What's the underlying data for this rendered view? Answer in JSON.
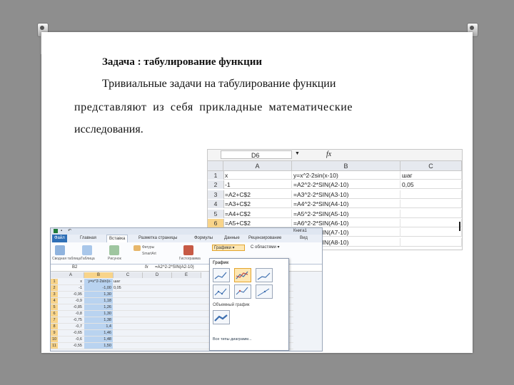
{
  "slide": {
    "title": "Задача : табулирование функции",
    "line1": "Тривиальные задачи на табулирование функции",
    "line2": "представляют из себя прикладные математические",
    "line3": "исследования."
  },
  "sheet_top": {
    "name_box": "D6",
    "fx": "fx",
    "columns": [
      "A",
      "B",
      "C"
    ],
    "rows": [
      {
        "n": "1",
        "a": "x",
        "b": "y=x^2-2sin(x-10)",
        "c": "шаг"
      },
      {
        "n": "2",
        "a": "-1",
        "b": "=A2^2-2*SIN(A2-10)",
        "c": "0,05"
      },
      {
        "n": "3",
        "a": "=A2+C$2",
        "b": "=A3^2-2*SIN(A3-10)",
        "c": ""
      },
      {
        "n": "4",
        "a": "=A3+C$2",
        "b": "=A4^2-2*SIN(A4-10)",
        "c": ""
      },
      {
        "n": "5",
        "a": "=A4+C$2",
        "b": "=A5^2-2*SIN(A5-10)",
        "c": ""
      },
      {
        "n": "6",
        "a": "=A5+C$2",
        "b": "=A6^2-2*SIN(A6-10)",
        "c": ""
      },
      {
        "n": "7",
        "a": "=A6+C$2",
        "b": "=A7^2-2*SIN(A7-10)",
        "c": ""
      },
      {
        "n": "8",
        "a": "=A7+C$2",
        "b": "=A8^2-2*SIN(A8-10)",
        "c": ""
      }
    ]
  },
  "excel_bottom": {
    "window_title": "Книга1",
    "tabs": [
      "Файл",
      "Главная",
      "Вставка",
      "Разметка страницы",
      "Формулы",
      "Данные",
      "Рецензирование",
      "Вид"
    ],
    "active_tab_index": 2,
    "ribbon_labels": [
      "Сводная таблица",
      "Таблица",
      "Рисунок",
      "Фигуры",
      "SmartArt",
      "Гистограмма",
      "Графики",
      "С областями"
    ],
    "name_box": "B2",
    "formula": "=A2^2-2*SIN(A2-10)",
    "columns": [
      "A",
      "B",
      "C",
      "D",
      "E"
    ],
    "rows": [
      {
        "n": "1",
        "a": "x",
        "b": "y=x^2-2sin(x-10)",
        "c": "шаг"
      },
      {
        "n": "2",
        "a": "-1",
        "b": "-1,00",
        "c": "0,05"
      },
      {
        "n": "3",
        "a": "-0,95",
        "b": "1,30",
        "c": ""
      },
      {
        "n": "4",
        "a": "-0,9",
        "b": "1,18",
        "c": ""
      },
      {
        "n": "5",
        "a": "-0,85",
        "b": "1,26",
        "c": ""
      },
      {
        "n": "6",
        "a": "-0,8",
        "b": "1,30",
        "c": ""
      },
      {
        "n": "7",
        "a": "-0,75",
        "b": "1,38",
        "c": ""
      },
      {
        "n": "8",
        "a": "-0,7",
        "b": "1,4",
        "c": ""
      },
      {
        "n": "9",
        "a": "-0,65",
        "b": "1,46",
        "c": ""
      },
      {
        "n": "10",
        "a": "-0,6",
        "b": "1,48",
        "c": ""
      },
      {
        "n": "11",
        "a": "-0,55",
        "b": "1,50",
        "c": ""
      }
    ],
    "popup": {
      "section1": "График",
      "section2": "Объемный график",
      "footer": "Все типы диаграмм..."
    }
  }
}
